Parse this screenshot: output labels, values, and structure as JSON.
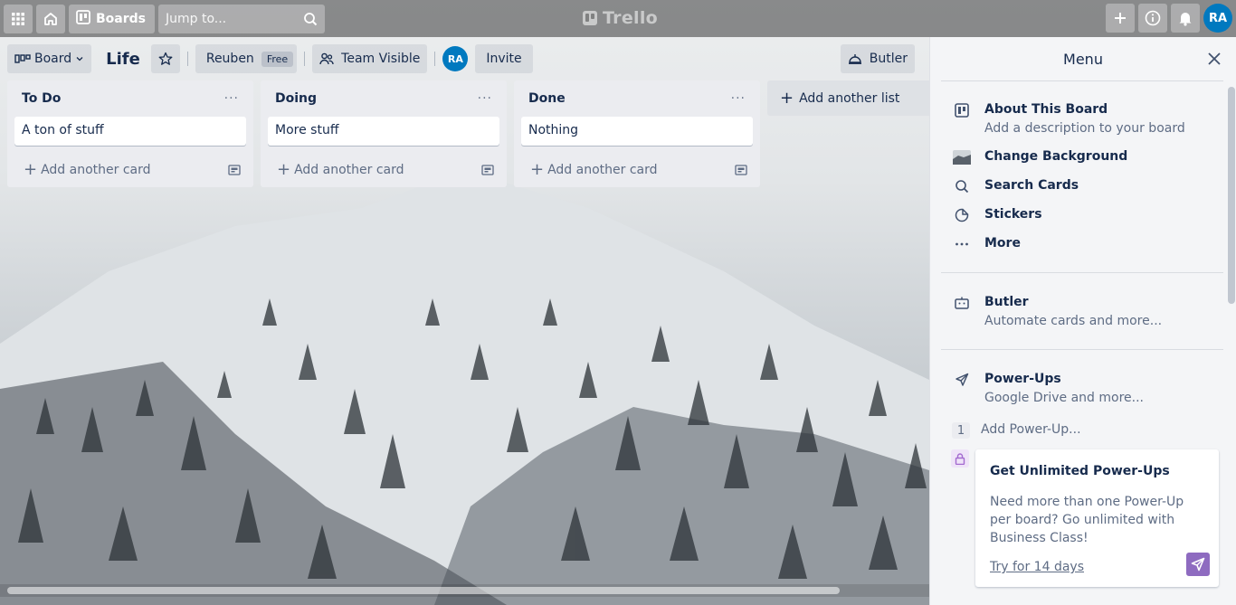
{
  "topbar": {
    "boards_label": "Boards",
    "search_placeholder": "Jump to...",
    "logo_text": "Trello",
    "user_initials": "RA"
  },
  "board_header": {
    "view_label": "Board",
    "board_name": "Life",
    "team_name": "Reuben",
    "team_plan": "Free",
    "visibility_label": "Team Visible",
    "member_initials": "RA",
    "invite_label": "Invite",
    "butler_label": "Butler"
  },
  "lists": [
    {
      "title": "To Do",
      "cards": [
        "A ton of stuff"
      ],
      "add_card_label": "Add another card"
    },
    {
      "title": "Doing",
      "cards": [
        "More stuff"
      ],
      "add_card_label": "Add another card"
    },
    {
      "title": "Done",
      "cards": [
        "Nothing"
      ],
      "add_card_label": "Add another card"
    }
  ],
  "add_list_label": "Add another list",
  "menu": {
    "title": "Menu",
    "items": [
      {
        "title": "About This Board",
        "subtitle": "Add a description to your board",
        "icon": "board-icon"
      },
      {
        "title": "Change Background",
        "icon": "background-thumbnail"
      },
      {
        "title": "Search Cards",
        "icon": "search-icon"
      },
      {
        "title": "Stickers",
        "icon": "sticker-icon"
      },
      {
        "title": "More",
        "icon": "more-dots-icon"
      }
    ],
    "butler": {
      "title": "Butler",
      "subtitle": "Automate cards and more...",
      "icon": "butler-icon"
    },
    "powerups": {
      "title": "Power-Ups",
      "subtitle": "Google Drive and more...",
      "icon": "rocket-icon",
      "count": "1",
      "add_label": "Add Power-Up..."
    },
    "promo": {
      "title": "Get Unlimited Power-Ups",
      "body": "Need more than one Power-Up per board? Go unlimited with Business Class!",
      "link": "Try for 14 days"
    }
  }
}
